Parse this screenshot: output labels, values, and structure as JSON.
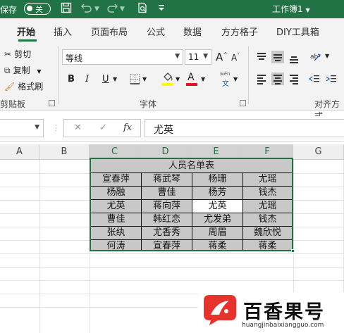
{
  "titlebar": {
    "autosave_label": "保存",
    "toggle_label": "关",
    "doc_name": "工作簿1"
  },
  "tabs": [
    "开始",
    "插入",
    "页面布局",
    "公式",
    "数据",
    "方方格子",
    "DIY工具箱"
  ],
  "clipboard": {
    "cut": "剪切",
    "copy": "复制",
    "format_painter": "格式刷",
    "group_label": "剪贴板"
  },
  "font": {
    "name": "等线",
    "size": "11",
    "group_label": "字体",
    "bold": "B",
    "italic": "I",
    "underline": "U",
    "grow": "A",
    "shrink": "A",
    "font_color_glyph": "A",
    "phonetic_top": "wén",
    "phonetic_bottom": "文",
    "font_color": "#e81123",
    "fill_color": "#ffff00"
  },
  "alignment": {
    "group_label": "对齐方式"
  },
  "formula_bar": {
    "cancel": "✕",
    "confirm": "✓",
    "fx": "fx",
    "value": "尤英"
  },
  "columns": [
    "A",
    "B",
    "C",
    "D",
    "E",
    "F",
    "G"
  ],
  "table": {
    "title": "人员名单表",
    "rows": [
      [
        "宣春萍",
        "蒋武琴",
        "杨珊",
        "尤瑶"
      ],
      [
        "杨融",
        "曹佳",
        "杨芳",
        "钱杰"
      ],
      [
        "尤英",
        "蒋向萍",
        "尤英",
        "尤瑶"
      ],
      [
        "曹佳",
        "韩红恋",
        "尤发弟",
        "钱杰"
      ],
      [
        "张纨",
        "尤香秀",
        "周眉",
        "魏欣悦"
      ],
      [
        "何涛",
        "宣春萍",
        "蒋柔",
        "蒋柔"
      ]
    ]
  },
  "watermark": {
    "brand": "百香果号",
    "url": "huangjinbaixiangguo.com"
  }
}
